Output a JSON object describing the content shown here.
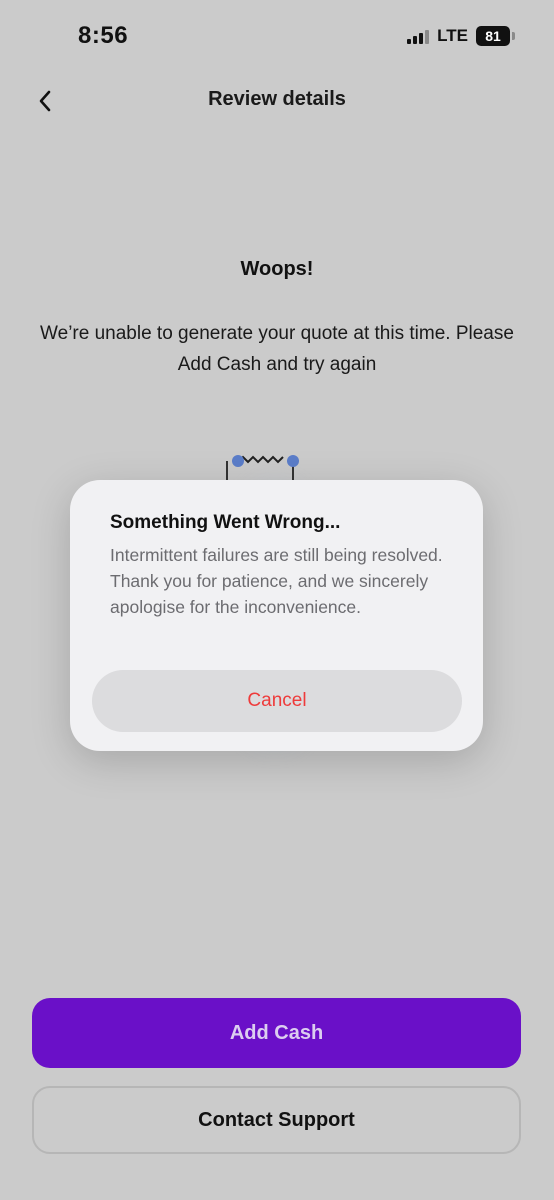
{
  "status_bar": {
    "time": "8:56",
    "network": "LTE",
    "battery": "81"
  },
  "nav": {
    "back_icon": "chevron-left-icon",
    "title": "Review details"
  },
  "error": {
    "heading": "Woops!",
    "message": "We’re unable to generate your quote at this time. Please Add Cash and try again"
  },
  "dialog": {
    "title": "Something Went Wrong...",
    "body": "Intermittent failures are still being resolved. Thank you for patience, and we sincerely apologise for the inconvenience.",
    "cancel_label": "Cancel",
    "cancel_color": "#ee3b3b"
  },
  "actions": {
    "add_cash_label": "Add Cash",
    "contact_support_label": "Contact Support",
    "primary_color": "#6a10c8"
  }
}
